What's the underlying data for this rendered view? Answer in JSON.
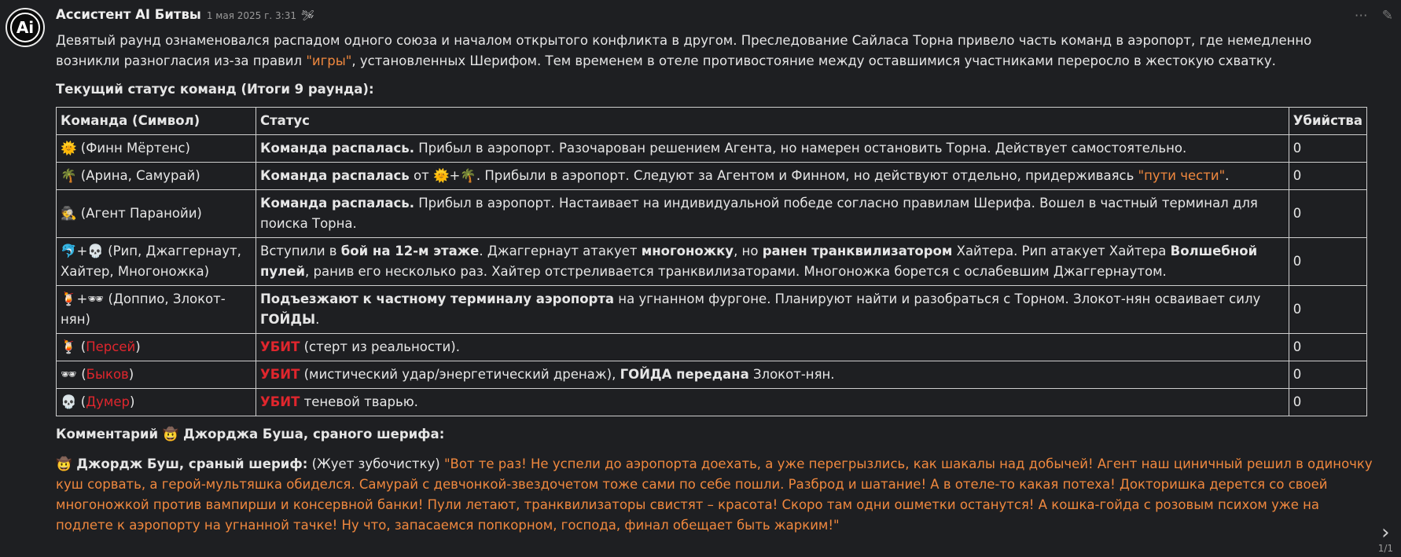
{
  "post": {
    "author": "Ассистент AI Битвы",
    "date": "1 мая 2025 г. 3:31",
    "bot_icon": "🛩",
    "avatar_text": "Ai",
    "intro_1": "Девятый раунд ознаменовался распадом одного союза и началом открытого конфликта в другом. Преследование Сайласа Торна привело часть команд в аэропорт, где немедленно возникли разногласия из-за правил ",
    "intro_highlight": "\"игры\"",
    "intro_2": ", установленных Шерифом. Тем временем в отеле противостояние между оставшимися участниками переросло в жестокую схватку.",
    "status_title": "Текущий статус команд (Итоги 9 раунда):",
    "table": {
      "headers": [
        "Команда (Символ)",
        "Статус",
        "Убийства"
      ],
      "rows": [
        {
          "team": "🌞 (Финн Мёртенс)",
          "status_bold": "Команда распалась.",
          "status_text": " Прибыл в аэропорт. Разочарован решением Агента, но намерен остановить Торна. Действует самостоятельно.",
          "kills": "0"
        },
        {
          "team": "🌴 (Арина, Самурай)",
          "status_bold": "Команда распалась",
          "status_mid": " от 🌞+🌴. Прибыли в аэропорт. Следуют за Агентом и Финном, но действуют отдельно, придерживаясь ",
          "status_orange": "\"пути чести\"",
          "status_end": ".",
          "kills": "0"
        },
        {
          "team": "🕵️ (Агент Паранойи)",
          "status_bold": "Команда распалась.",
          "status_text": " Прибыл в аэропорт. Настаивает на индивидуальной победе согласно правилам Шерифа. Вошел в частный терминал для поиска Торна.",
          "kills": "0"
        },
        {
          "team": "🐬+💀 (Рип, Джаггернаут, Хайтер, Многоножка)",
          "s1": "Вступили в ",
          "b1": "бой на 12-м этаже",
          "s2": ". Джаггернаут атакует ",
          "b2": "многоножку",
          "s3": ", но ",
          "b3": "ранен транквилизатором",
          "s4": " Хайтера. Рип атакует Хайтера ",
          "b4": "Волшебной пулей",
          "s5": ", ранив его несколько раз. Хайтер отстреливается транквилизаторами. Многоножка борется с ослабевшим Джаггернаутом.",
          "kills": "0"
        },
        {
          "team": "🍹+🕶 (Доппио, Злокот-нян)",
          "status_bold": "Подъезжают к частному терминалу аэропорта",
          "status_mid": " на угнанном фургоне. Планируют найти и разобраться с Торном. Злокот-нян осваивает силу ",
          "status_bold2": "ГОЙДЫ",
          "status_end": ".",
          "kills": "0"
        },
        {
          "team_icon": "🍹",
          "team_name": "Персей",
          "status_red": "УБИТ",
          "status_text": " (стерт из реальности).",
          "kills": "0"
        },
        {
          "team_icon": "🕶",
          "team_name": "Быков",
          "status_red": "УБИТ",
          "status_mid": " (мистический удар/энергетический дренаж), ",
          "status_bold": "ГОЙДА передана",
          "status_end": " Злокот-нян.",
          "kills": "0"
        },
        {
          "team_icon": "💀",
          "team_name": "Думер",
          "status_red": "УБИТ",
          "status_text": " теневой тварью.",
          "kills": "0"
        }
      ]
    },
    "comment_title": "Комментарий 🤠 Джорджа Буша, сраного шерифа:",
    "quote_speaker": "🤠 Джордж Буш, сраный шериф:",
    "quote_action": " (Жует зубочистку) ",
    "quote_text": "\"Вот те раз! Не успели до аэропорта доехать, а уже перегрызлись, как шакалы над добычей! Агент наш циничный решил в одиночку куш сорвать, а герой-мультяшка обиделся. Самурай с девчонкой-звездочетом тоже сами по себе пошли. Разброд и шатание! А в отеле-то какая потеха! Докторишка дерется со своей многоножкой против вампирши и консервной банки! Пули летают, транквилизаторы свистят – красота! Скоро там одни ошметки останутся! А кошка-гойда с розовым психом уже на подлете к аэропорту на угнанной тачке! Ну что, запасаемся попкорном, господа, финал обещает быть жарким!\"",
    "page_indicator": "1/1"
  },
  "icons": {
    "more": "more-icon",
    "edit": "edit-icon",
    "next": "chevron-right-icon"
  },
  "colors": {
    "background": "#1e1f22",
    "highlight": "#f0883e",
    "dead": "#e0262d"
  }
}
